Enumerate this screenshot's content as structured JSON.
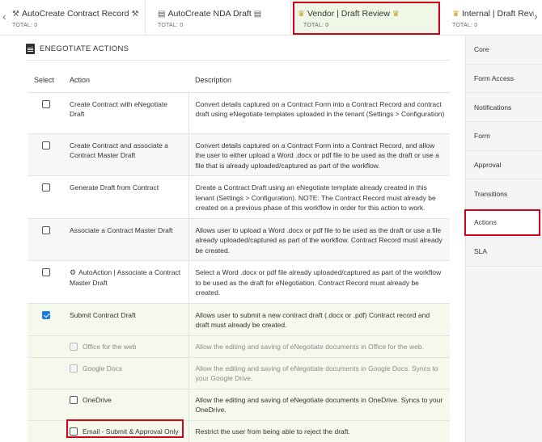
{
  "tabs": [
    {
      "title": "AutoCreate Contract Record",
      "total": "TOTAL: 0",
      "icon": "tools-icon"
    },
    {
      "title": "AutoCreate NDA Draft",
      "total": "TOTAL: 0",
      "icon": "document-icon"
    },
    {
      "title": "Vendor | Draft Review",
      "total": "TOTAL: 0",
      "icon": "trophy-icon"
    },
    {
      "title": "Internal | Draft Revie",
      "total": "TOTAL: 0",
      "icon": "trophy-icon"
    }
  ],
  "section": {
    "title": "ENEGOTIATE ACTIONS"
  },
  "table": {
    "headers": {
      "select": "Select",
      "action": "Action",
      "description": "Description"
    },
    "rows": [
      {
        "action": "Create Contract with eNegotiate Draft",
        "description": "Convert details captured on a Contract Form into a Contract Record and contract draft using eNegotiate templates uploaded in the tenant (Settings > Configuration)",
        "checked": false
      },
      {
        "action": "Create Contract and associate a Contract Master Draft",
        "description": "Convert details captured on a Contract Form into a Contract Record, and allow the user to either upload a Word .docx or pdf file to be used as the draft or use a file that is already uploaded/captured as part of the workflow.",
        "checked": false
      },
      {
        "action": "Generate Draft from Contract",
        "description": "Create a Contract Draft using an eNegotiate template already created in this tenant (Settings > Configuration). NOTE: The Contract Record must already be created on a previous phase of this workflow in order for this action to work.",
        "checked": false
      },
      {
        "action": "Associate a Contract Master Draft",
        "description": "Allows user to upload a Word .docx or pdf file to be used as the draft or use a file already uploaded/captured as part of the workflow. Contract Record must already be created.",
        "checked": false
      },
      {
        "action": "AutoAction | Associate a Contract Master Draft",
        "description": "Select a Word .docx or pdf file already uploaded/captured as part of the workflow to be used as the draft for eNegotiation. Contract Record must already be created.",
        "checked": false
      },
      {
        "action": "Submit Contract Draft",
        "description": "Allows user to submit a new contract draft (.docx or .pdf) Contract record and draft must already be created.",
        "checked": true
      }
    ],
    "sub_options": [
      {
        "label": "Office for the web",
        "description": "Allow the editing and saving of eNegotiate documents in Office for the web."
      },
      {
        "label": "Google Docs",
        "description": "Allow the editing and saving of eNegotiate documents in Google Docs. Syncs to your Google Drive."
      },
      {
        "label": "OneDrive",
        "description": "Allow the editing and saving of eNegotiate documents in OneDrive. Syncs to your OneDrive."
      },
      {
        "label": "Email - Submit & Approval Only",
        "description": "Restrict the user from being able to reject the draft."
      }
    ]
  },
  "nav": [
    "Core",
    "Form Access",
    "Notifications",
    "Form",
    "Approval",
    "Transitions",
    "Actions",
    "SLA"
  ],
  "colors": {
    "highlight": "#d0021b",
    "active_tab": "#f0f7e6",
    "checkbox": "#1a7be0"
  }
}
